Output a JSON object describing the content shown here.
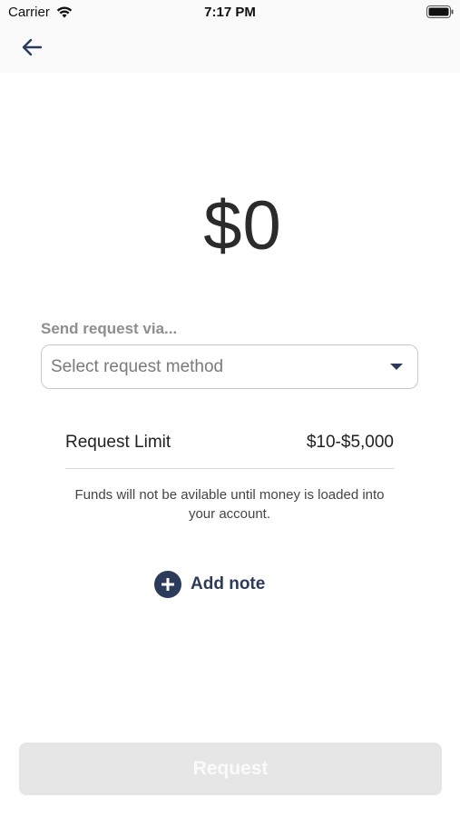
{
  "status_bar": {
    "carrier": "Carrier",
    "time": "7:17 PM"
  },
  "amount": "$0",
  "send_request": {
    "label": "Send request via...",
    "placeholder": "Select request method"
  },
  "limit": {
    "label": "Request Limit",
    "value": "$10-$5,000"
  },
  "funds_note": "Funds will not be avilable until money is loaded into your account.",
  "add_note_label": "Add note",
  "request_button_label": "Request",
  "colors": {
    "accent": "#2c3a5c",
    "button_disabled": "#e6e6e6"
  }
}
